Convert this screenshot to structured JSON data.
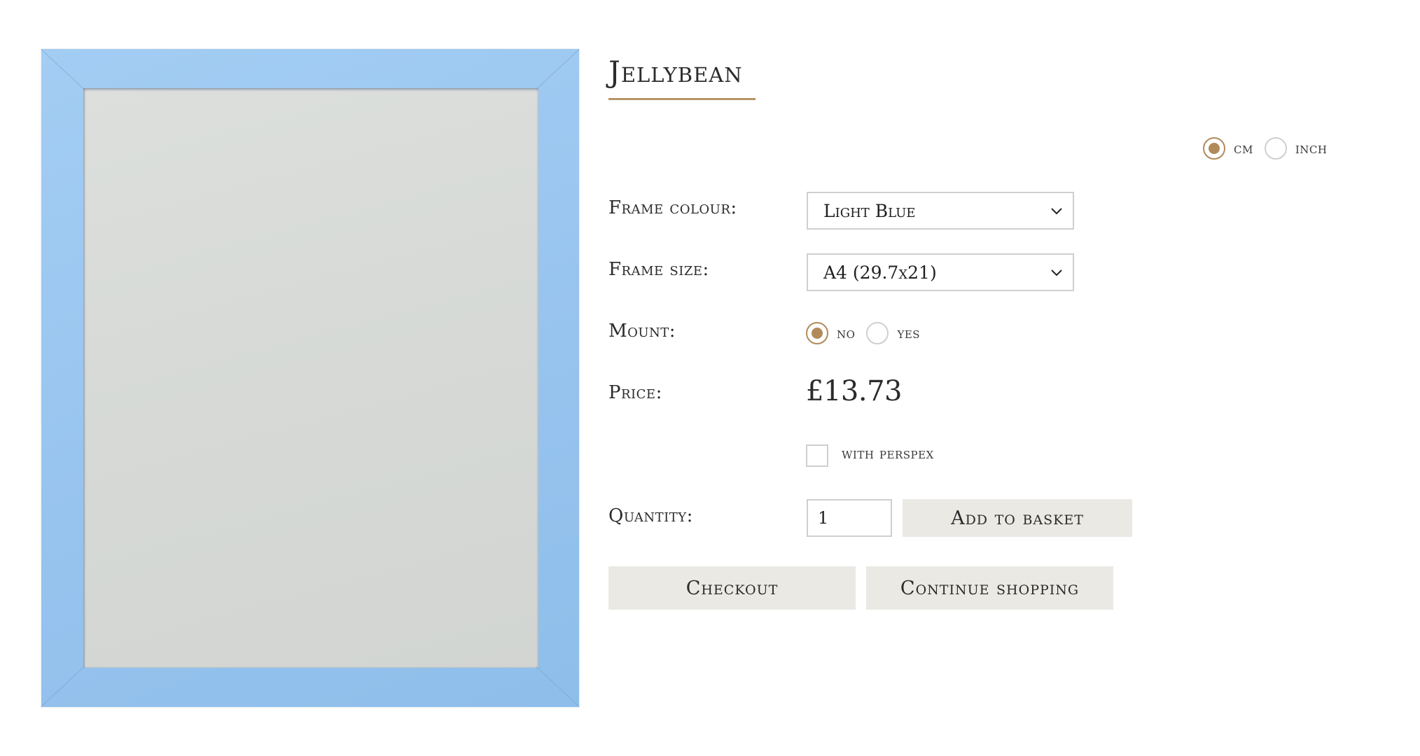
{
  "product": {
    "title": "Jellybean",
    "image_alt_colour": "#9ac6f0"
  },
  "units": {
    "options": [
      {
        "label": "cm",
        "selected": true
      },
      {
        "label": "inch",
        "selected": false
      }
    ]
  },
  "frame_colour": {
    "label": "Frame colour:",
    "value": "Light Blue"
  },
  "frame_size": {
    "label": "Frame size:",
    "value": "A4 (29.7x21)"
  },
  "mount": {
    "label": "Mount:",
    "options": [
      {
        "label": "no",
        "selected": true
      },
      {
        "label": "yes",
        "selected": false
      }
    ]
  },
  "price": {
    "label": "Price:",
    "value": "£13.73"
  },
  "perspex": {
    "label": "with perspex",
    "checked": false
  },
  "quantity": {
    "label": "Quantity:",
    "value": "1"
  },
  "buttons": {
    "add_to_basket": "Add to basket",
    "checkout": "Checkout",
    "continue_shopping": "Continue shopping"
  },
  "colors": {
    "accent": "#b08a5a",
    "button_bg": "#ebe9e4",
    "frame_blue": "#9ac6f0"
  }
}
